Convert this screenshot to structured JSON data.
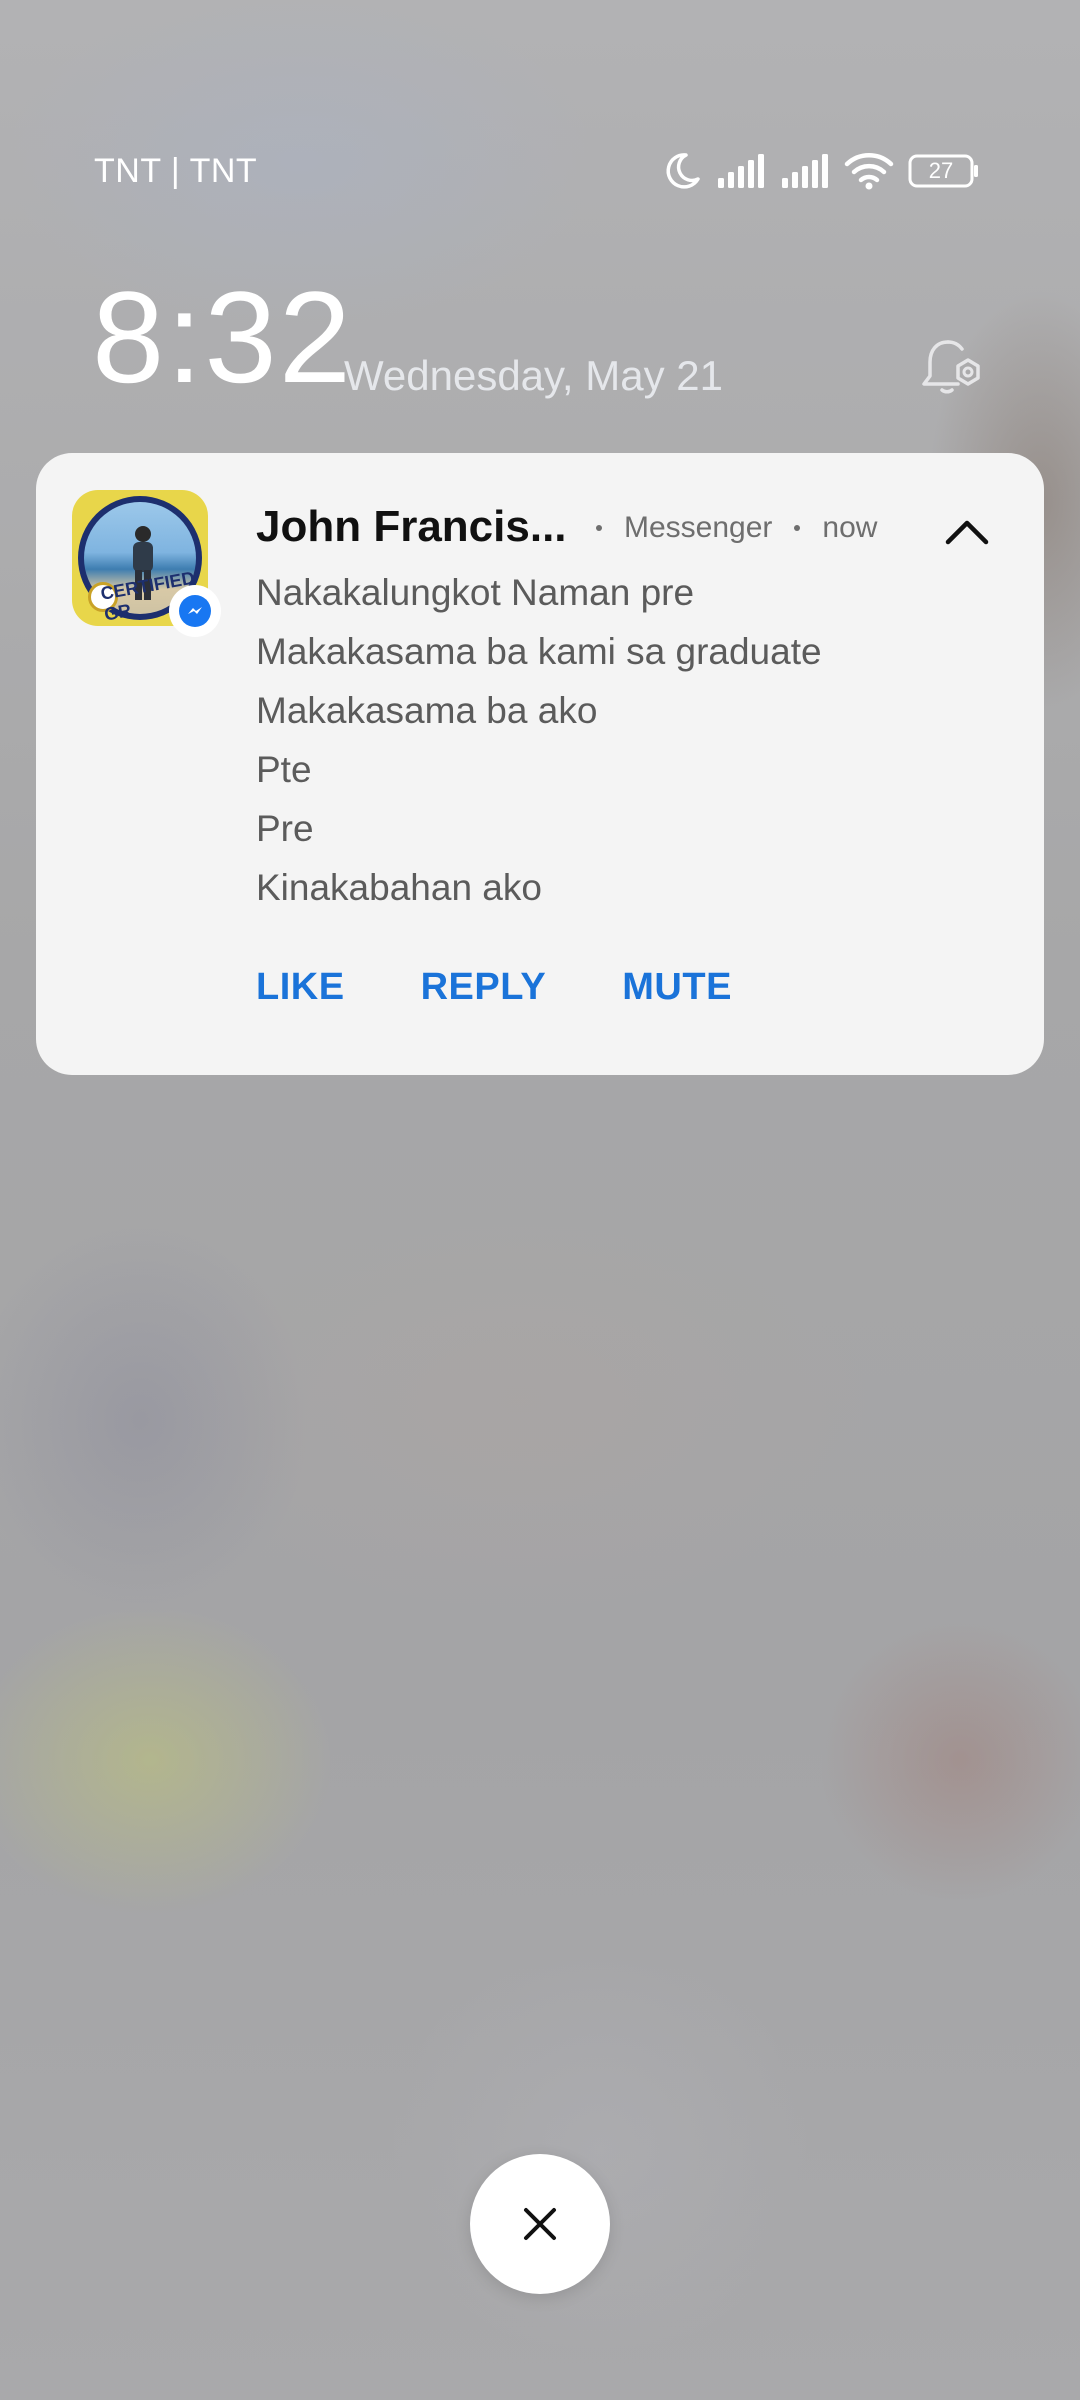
{
  "status_bar": {
    "carrier": "TNT | TNT",
    "battery_level": "27",
    "icons": [
      "moon-icon",
      "signal-icon",
      "signal-icon",
      "wifi-icon",
      "battery-icon"
    ]
  },
  "lock_screen": {
    "time": "8:32",
    "date": "Wednesday, May 21",
    "settings_icon": "alarm-settings-icon"
  },
  "notification": {
    "sender": "John Francis...",
    "app": "Messenger",
    "time": "now",
    "avatar_badge_text": "CERTIFIED GR",
    "messages": [
      "Nakakalungkot Naman pre",
      "Makakasama ba kami sa graduate",
      "Makakasama ba ako",
      "Pte",
      "Pre",
      "Kinakabahan ako"
    ],
    "actions": {
      "like": "LIKE",
      "reply": "REPLY",
      "mute": "MUTE"
    },
    "accent_color": "#1a73d9"
  },
  "dismiss": {
    "icon": "close-icon"
  }
}
